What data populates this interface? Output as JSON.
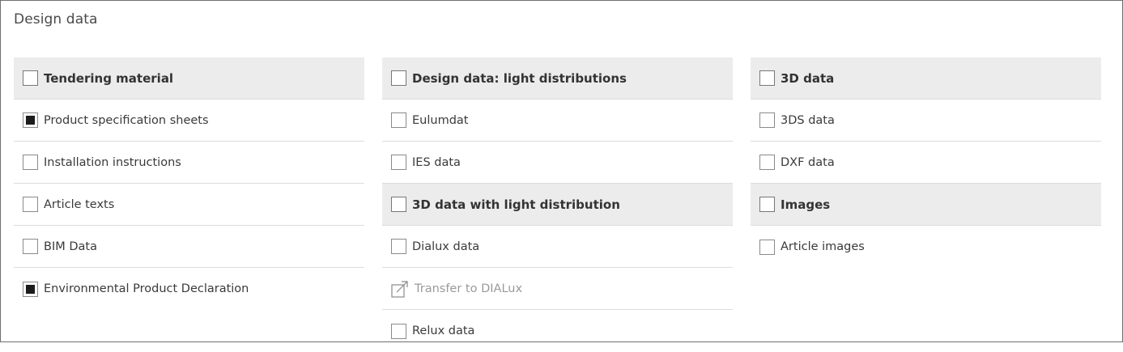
{
  "panel": {
    "title": "Design data"
  },
  "columns": [
    {
      "sections": [
        {
          "header": {
            "label": "Tendering material",
            "checked": false
          },
          "items": [
            {
              "label": "Product specification sheets",
              "checked": true
            },
            {
              "label": "Installation instructions",
              "checked": false
            },
            {
              "label": "Article texts",
              "checked": false
            },
            {
              "label": "BIM Data",
              "checked": false
            },
            {
              "label": "Environmental Product Declaration",
              "checked": true
            }
          ]
        }
      ]
    },
    {
      "sections": [
        {
          "header": {
            "label": "Design data: light distributions",
            "checked": false
          },
          "items": [
            {
              "label": "Eulumdat",
              "checked": false
            },
            {
              "label": "IES data",
              "checked": false
            }
          ]
        },
        {
          "header": {
            "label": "3D data with light distribution",
            "checked": false
          },
          "items": [
            {
              "label": "Dialux data",
              "checked": false
            },
            {
              "label": "Transfer to DIALux",
              "icon": "external-link-icon",
              "disabled": true
            },
            {
              "label": "Relux data",
              "checked": false
            }
          ]
        }
      ]
    },
    {
      "sections": [
        {
          "header": {
            "label": "3D data",
            "checked": false
          },
          "items": [
            {
              "label": "3DS data",
              "checked": false
            },
            {
              "label": "DXF data",
              "checked": false
            }
          ]
        },
        {
          "header": {
            "label": "Images",
            "checked": false
          },
          "items": [
            {
              "label": "Article images",
              "checked": false
            }
          ]
        }
      ]
    }
  ],
  "colors": {
    "header_bg": "#ececec",
    "border": "#dcdcdc",
    "checked_fill": "#1c1c1c",
    "disabled_text": "#9a9a9a"
  }
}
